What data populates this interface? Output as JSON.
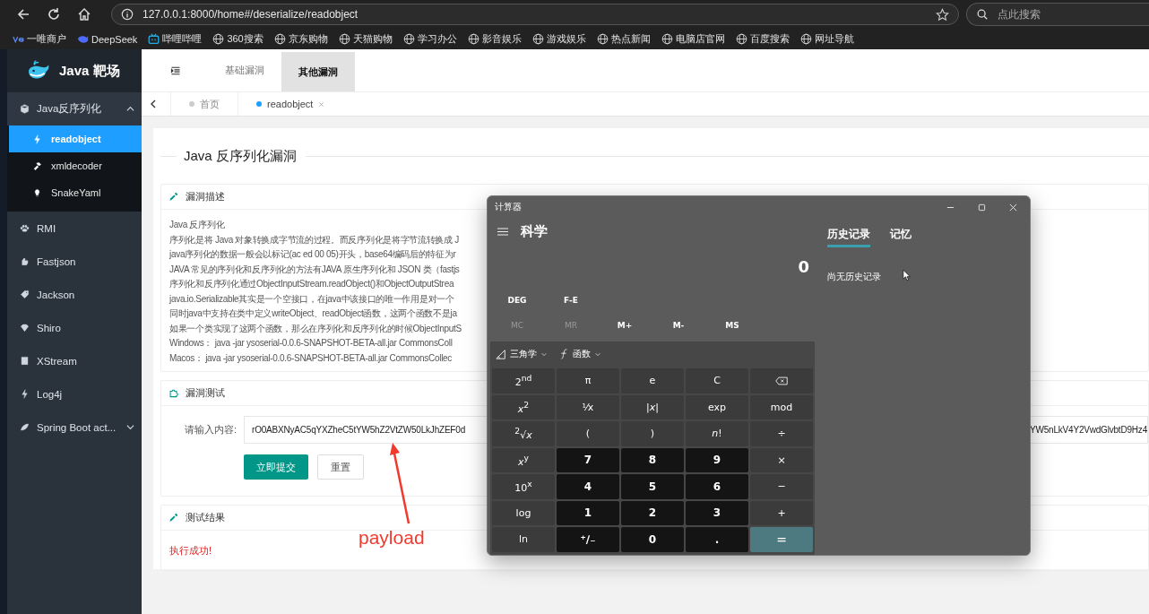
{
  "browser": {
    "url": "127.0.0.1:8000/home#/deserialize/readobject",
    "search_placeholder": "点此搜索",
    "bookmarks": [
      {
        "label": "一唯商户"
      },
      {
        "label": "DeepSeek"
      },
      {
        "label": "哔哩哔哩"
      },
      {
        "label": "360搜索"
      },
      {
        "label": "京东购物"
      },
      {
        "label": "天猫购物"
      },
      {
        "label": "学习办公"
      },
      {
        "label": "影音娱乐"
      },
      {
        "label": "游戏娱乐"
      },
      {
        "label": "热点新闻"
      },
      {
        "label": "电脑店官网"
      },
      {
        "label": "百度搜索"
      },
      {
        "label": "网址导航"
      }
    ]
  },
  "sidebar": {
    "logo": "Java 靶场",
    "items": [
      {
        "label": "Java反序列化",
        "kind": "group",
        "expanded": true,
        "selected": false,
        "children": [
          {
            "label": "readobject",
            "selected": true
          },
          {
            "label": "xmldecoder",
            "selected": false
          },
          {
            "label": "SnakeYaml",
            "selected": false
          }
        ]
      },
      {
        "label": "RMI",
        "kind": "link",
        "selected": false
      },
      {
        "label": "Fastjson",
        "kind": "link",
        "selected": false
      },
      {
        "label": "Jackson",
        "kind": "link",
        "selected": false
      },
      {
        "label": "Shiro",
        "kind": "link",
        "selected": false
      },
      {
        "label": "XStream",
        "kind": "link",
        "selected": false
      },
      {
        "label": "Log4j",
        "kind": "link",
        "selected": false
      },
      {
        "label": "Spring Boot act...",
        "kind": "group",
        "expanded": false,
        "selected": false
      }
    ]
  },
  "top_tabs": [
    {
      "label": "基础漏洞",
      "selected": false
    },
    {
      "label": "其他漏洞",
      "selected": true
    }
  ],
  "page_tabs": [
    {
      "label": "首页",
      "selected": false,
      "closable": false
    },
    {
      "label": "readobject",
      "selected": true,
      "closable": true
    }
  ],
  "content": {
    "title": "Java 反序列化漏洞",
    "sections": [
      {
        "kind": "text",
        "title": "漏洞描述",
        "lines": [
          "Java 反序列化",
          "序列化是将 Java 对象转换成字节流的过程。而反序列化是将字节流转换成 J",
          "java序列化的数据一般会以标记(ac ed 00 05)开头，base64编码后的特征为r",
          "JAVA 常见的序列化和反序列化的方法有JAVA 原生序列化和 JSON 类（fastjs",
          "序列化和反序列化通过ObjectInputStream.readObject()和ObjectOutputStrea",
          "java.io.Serializable其实是一个空接口，在java中该接口的唯一作用是对一个",
          "同时java中支持在类中定义writeObject、readObject函数，这两个函数不是ja",
          "如果一个类实现了这两个函数，那么在序列化和反序列化的时候ObjectInputS",
          "Windows： java -jar ysoserial-0.0.6-SNAPSHOT-BETA-all.jar CommonsColl",
          "Macos： java -jar ysoserial-0.0.6-SNAPSHOT-BETA-all.jar CommonsCollec"
        ]
      },
      {
        "kind": "form",
        "title": "漏洞测试",
        "field_label": "请输入内容:",
        "value_start": "rO0ABXNyAC5qYXZheC5tYW5hZ2VtZW50LkJhZEF0d",
        "value_end": "YW5nLkV4Y2VwdGlvbtD9Hz4",
        "buttons": [
          {
            "label": "立即提交",
            "kind": "primary"
          },
          {
            "label": "重置",
            "kind": "plain"
          }
        ]
      },
      {
        "kind": "result",
        "title": "测试结果",
        "message": "执行成功!"
      }
    ]
  },
  "annotation": {
    "text": "payload"
  },
  "calculator": {
    "title": "计算器",
    "mode": "科学",
    "display": "0",
    "history_empty": "尚无历史记录",
    "panel_tabs": [
      {
        "label": "历史记录",
        "selected": true
      },
      {
        "label": "记忆",
        "selected": false
      }
    ],
    "settings": [
      "DEG",
      "F-E"
    ],
    "memory": [
      {
        "label": "MC",
        "disabled": true
      },
      {
        "label": "MR",
        "disabled": true
      },
      {
        "label": "M+",
        "disabled": false
      },
      {
        "label": "M-",
        "disabled": false
      },
      {
        "label": "MS",
        "disabled": false
      }
    ],
    "dropdowns": [
      "三角学",
      "函数"
    ],
    "keys": [
      {
        "label": "2$^{nd}$",
        "kind": "func"
      },
      {
        "label": "π",
        "kind": "func"
      },
      {
        "label": "e",
        "kind": "func"
      },
      {
        "label": "C",
        "kind": "func"
      },
      {
        "kind": "backspace"
      },
      {
        "label": "*x*$^{2}$",
        "kind": "func"
      },
      {
        "label": "⅟x",
        "kind": "func"
      },
      {
        "label": "|*x*|",
        "kind": "func"
      },
      {
        "label": "exp",
        "kind": "func"
      },
      {
        "label": "mod",
        "kind": "func"
      },
      {
        "label": "$^{2}$√*x*",
        "kind": "func"
      },
      {
        "label": "(",
        "kind": "func"
      },
      {
        "label": ")",
        "kind": "func"
      },
      {
        "label": "*n*!",
        "kind": "func"
      },
      {
        "label": "÷",
        "kind": "func"
      },
      {
        "label": "*x*$^{y}$",
        "kind": "func"
      },
      {
        "label": "7",
        "kind": "num"
      },
      {
        "label": "8",
        "kind": "num"
      },
      {
        "label": "9",
        "kind": "num"
      },
      {
        "label": "×",
        "kind": "func"
      },
      {
        "label": "10$^{x}$",
        "kind": "func"
      },
      {
        "label": "4",
        "kind": "num"
      },
      {
        "label": "5",
        "kind": "num"
      },
      {
        "label": "6",
        "kind": "num"
      },
      {
        "label": "−",
        "kind": "func"
      },
      {
        "label": "log",
        "kind": "func"
      },
      {
        "label": "1",
        "kind": "num"
      },
      {
        "label": "2",
        "kind": "num"
      },
      {
        "label": "3",
        "kind": "num"
      },
      {
        "label": "+",
        "kind": "func"
      },
      {
        "label": "ln",
        "kind": "func"
      },
      {
        "label": "⁺∕₋",
        "kind": "num"
      },
      {
        "label": "0",
        "kind": "num"
      },
      {
        "label": ".",
        "kind": "num"
      },
      {
        "label": "=",
        "kind": "equals"
      }
    ]
  }
}
